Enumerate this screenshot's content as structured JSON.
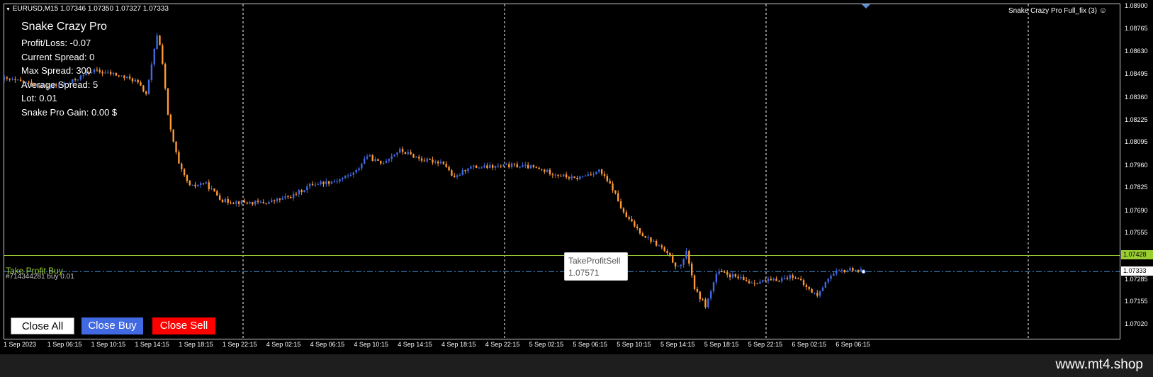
{
  "header": {
    "symbol_info": "EURUSD,M15  1.07346 1.07350 1.07327 1.07333",
    "indicator_name": "Snake Crazy Pro Full_fix (3)"
  },
  "info_panel": {
    "title": "Snake Crazy Pro",
    "lines": [
      "Profit/Loss: -0.07",
      "Current Spread: 0",
      "Max Spread: 300",
      "Average Spread: 5",
      "Lot: 0.01",
      "Snake Pro Gain: 0.00 $"
    ]
  },
  "buttons": {
    "close_all": "Close All",
    "close_buy": "Close Buy",
    "close_sell": "Close Sell"
  },
  "lines": {
    "take_profit_buy_label": "Take Profit Buy",
    "order_label": "#714344281 buy 0.01",
    "take_profit_buy_price": "1.07428",
    "current_price": "1.07333"
  },
  "tooltip": {
    "name": "TakeProfitSell",
    "value": "1.07571"
  },
  "price_axis": [
    "1.08900",
    "1.08765",
    "1.08630",
    "1.08495",
    "1.08360",
    "1.08225",
    "1.08095",
    "1.07960",
    "1.07825",
    "1.07690",
    "1.07555",
    "1.07285",
    "1.07155",
    "1.07020"
  ],
  "time_axis": [
    "1 Sep 2023",
    "1 Sep 06:15",
    "1 Sep 10:15",
    "1 Sep 14:15",
    "1 Sep 18:15",
    "1 Sep 22:15",
    "4 Sep 02:15",
    "4 Sep 06:15",
    "4 Sep 10:15",
    "4 Sep 14:15",
    "4 Sep 18:15",
    "4 Sep 22:15",
    "5 Sep 02:15",
    "5 Sep 06:15",
    "5 Sep 10:15",
    "5 Sep 14:15",
    "5 Sep 18:15",
    "5 Sep 22:15",
    "6 Sep 02:15",
    "6 Sep 06:15"
  ],
  "brand": "www.mt4.shop",
  "colors": {
    "background": "#000000",
    "bull_candle": "#4169e1",
    "bear_candle": "#ff9933",
    "take_profit_line": "#9acd32",
    "order_line": "#4a90d9",
    "grid": "#ffffff"
  },
  "chart_data": {
    "type": "candlestick",
    "symbol": "EURUSD",
    "timeframe": "M15",
    "ylim": [
      1.0702,
      1.089
    ],
    "close_path": [
      [
        "1 Sep 00:00",
        1.0847
      ],
      [
        "1 Sep 02:00",
        1.0845
      ],
      [
        "1 Sep 04:00",
        1.0842
      ],
      [
        "1 Sep 06:00",
        1.0845
      ],
      [
        "1 Sep 08:00",
        1.0852
      ],
      [
        "1 Sep 10:00",
        1.085
      ],
      [
        "1 Sep 12:00",
        1.0846
      ],
      [
        "1 Sep 13:00",
        1.0838
      ],
      [
        "1 Sep 14:00",
        1.0875
      ],
      [
        "1 Sep 14:30",
        1.0855
      ],
      [
        "1 Sep 15:00",
        1.0822
      ],
      [
        "1 Sep 16:00",
        1.0795
      ],
      [
        "1 Sep 17:00",
        1.0783
      ],
      [
        "1 Sep 18:15",
        1.0786
      ],
      [
        "1 Sep 20:00",
        1.0775
      ],
      [
        "1 Sep 22:15",
        1.0774
      ],
      [
        "2 Sep 00:00",
        1.0774
      ],
      [
        "4 Sep 02:15",
        1.0778
      ],
      [
        "4 Sep 04:00",
        1.0785
      ],
      [
        "4 Sep 06:15",
        1.0787
      ],
      [
        "4 Sep 08:00",
        1.0792
      ],
      [
        "4 Sep 09:00",
        1.0802
      ],
      [
        "4 Sep 10:15",
        1.0797
      ],
      [
        "4 Sep 12:00",
        1.0805
      ],
      [
        "4 Sep 14:15",
        1.0799
      ],
      [
        "4 Sep 16:00",
        1.0798
      ],
      [
        "4 Sep 17:00",
        1.0788
      ],
      [
        "4 Sep 18:15",
        1.0795
      ],
      [
        "4 Sep 20:00",
        1.0795
      ],
      [
        "4 Sep 22:15",
        1.0796
      ],
      [
        "5 Sep 00:00",
        1.0795
      ],
      [
        "5 Sep 02:15",
        1.0791
      ],
      [
        "5 Sep 04:00",
        1.0788
      ],
      [
        "5 Sep 06:15",
        1.0793
      ],
      [
        "5 Sep 07:30",
        1.0782
      ],
      [
        "5 Sep 08:30",
        1.0767
      ],
      [
        "5 Sep 10:15",
        1.0755
      ],
      [
        "5 Sep 12:00",
        1.0747
      ],
      [
        "5 Sep 13:30",
        1.0735
      ],
      [
        "5 Sep 14:15",
        1.0745
      ],
      [
        "5 Sep 15:00",
        1.0722
      ],
      [
        "5 Sep 16:00",
        1.0713
      ],
      [
        "5 Sep 17:00",
        1.0733
      ],
      [
        "5 Sep 18:15",
        1.0731
      ],
      [
        "5 Sep 20:00",
        1.0727
      ],
      [
        "5 Sep 22:15",
        1.0728
      ],
      [
        "6 Sep 00:00",
        1.0731
      ],
      [
        "6 Sep 01:30",
        1.0722
      ],
      [
        "6 Sep 02:15",
        1.0719
      ],
      [
        "6 Sep 03:00",
        1.0729
      ],
      [
        "6 Sep 04:00",
        1.0733
      ],
      [
        "6 Sep 05:30",
        1.0735
      ],
      [
        "6 Sep 06:15",
        1.07333
      ]
    ]
  }
}
